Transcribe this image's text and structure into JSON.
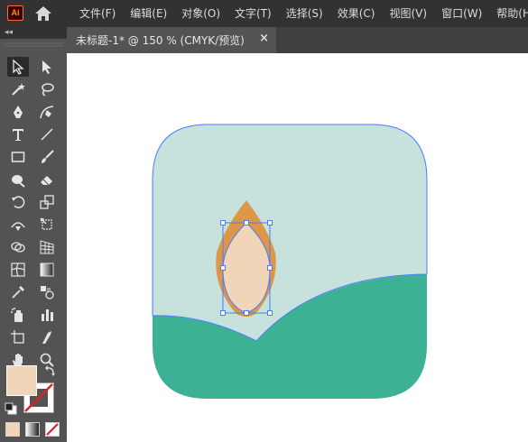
{
  "app": {
    "logo_text": "Ai"
  },
  "menu": {
    "items": [
      {
        "label": "文件(F)"
      },
      {
        "label": "编辑(E)"
      },
      {
        "label": "对象(O)"
      },
      {
        "label": "文字(T)"
      },
      {
        "label": "选择(S)"
      },
      {
        "label": "效果(C)"
      },
      {
        "label": "视图(V)"
      },
      {
        "label": "窗口(W)"
      },
      {
        "label": "帮助(H)"
      }
    ]
  },
  "toolbar": {
    "collapse_glyph": "◂◂",
    "tools": [
      {
        "name": "selection-tool-icon",
        "selected": true
      },
      {
        "name": "direct-selection-tool-icon"
      },
      {
        "name": "magic-wand-tool-icon"
      },
      {
        "name": "lasso-tool-icon"
      },
      {
        "name": "pen-tool-icon"
      },
      {
        "name": "curvature-tool-icon"
      },
      {
        "name": "type-tool-icon"
      },
      {
        "name": "line-segment-tool-icon"
      },
      {
        "name": "rectangle-tool-icon"
      },
      {
        "name": "paintbrush-tool-icon"
      },
      {
        "name": "shaper-tool-icon"
      },
      {
        "name": "eraser-tool-icon"
      },
      {
        "name": "rotate-tool-icon"
      },
      {
        "name": "scale-tool-icon"
      },
      {
        "name": "width-tool-icon"
      },
      {
        "name": "free-transform-tool-icon"
      },
      {
        "name": "shape-builder-tool-icon"
      },
      {
        "name": "perspective-grid-tool-icon"
      },
      {
        "name": "mesh-tool-icon"
      },
      {
        "name": "gradient-tool-icon"
      },
      {
        "name": "eyedropper-tool-icon"
      },
      {
        "name": "blend-tool-icon"
      },
      {
        "name": "symbol-sprayer-tool-icon"
      },
      {
        "name": "column-graph-tool-icon"
      },
      {
        "name": "artboard-tool-icon"
      },
      {
        "name": "slice-tool-icon"
      },
      {
        "name": "hand-tool-icon"
      },
      {
        "name": "zoom-tool-icon"
      }
    ],
    "fill_color": "#f0d5b8",
    "stroke_color": "none"
  },
  "document": {
    "tab_title": "未标题-1* @ 150 % (CMYK/预览)",
    "close_glyph": "×"
  },
  "colors": {
    "menubar_bg": "#323232",
    "panel_bg": "#535353",
    "canvas_bg": "#ffffff",
    "icon_bg": "#c7e2dd",
    "hill": "#3cb194",
    "flame_outer": "#dc9748",
    "flame_inner": "#f0d5b8",
    "selection_blue": "#4a7bff"
  }
}
